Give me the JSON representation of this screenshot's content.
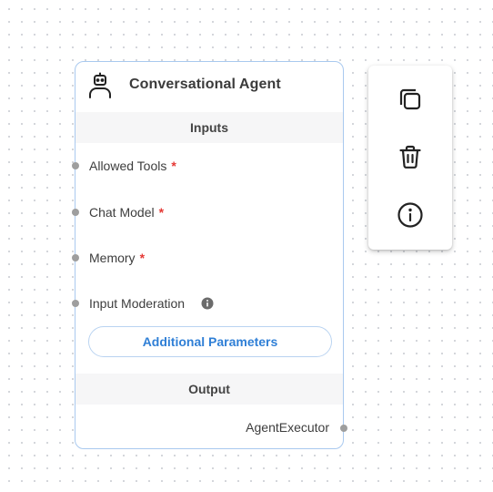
{
  "node": {
    "icon": "robot-agent-icon",
    "title": "Conversational Agent",
    "inputs_header": "Inputs",
    "params": [
      {
        "label": "Allowed Tools",
        "required": "*"
      },
      {
        "label": "Chat Model",
        "required": "*"
      },
      {
        "label": "Memory",
        "required": "*"
      },
      {
        "label": "Input Moderation",
        "info_icon": "info-icon"
      }
    ],
    "additional_button": "Additional Parameters",
    "output_header": "Output",
    "output_label": "AgentExecutor"
  },
  "toolbar": {
    "icons": [
      "copy-icon",
      "trash-icon",
      "info-circle-icon"
    ]
  },
  "colors": {
    "node_border": "#a9c9ef",
    "accent": "#2f7fd6",
    "required": "#e53935",
    "handle": "#9e9e9e"
  }
}
